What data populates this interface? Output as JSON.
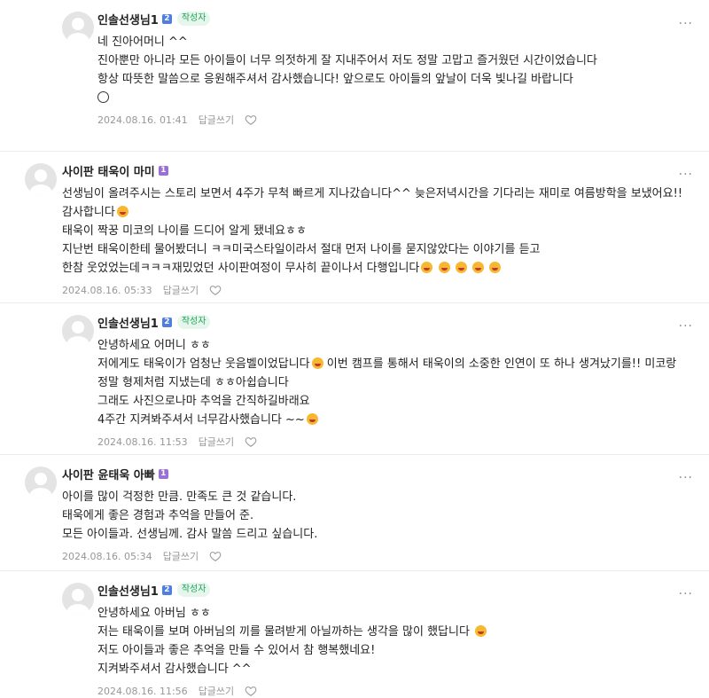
{
  "ui": {
    "reply_label": "답글쓰기",
    "author_badge": "작성자",
    "more_label": "···"
  },
  "comments": [
    {
      "nickname": "인솔선생님1",
      "level": "2",
      "is_author": true,
      "is_reply": true,
      "lines": [
        "네 진아어머니 ^^",
        "진아뿐만 아니라 모든 아이들이 너무 의젓하게 잘 지내주어서 저도 정말 고맙고 즐거웠던 시간이었습니다",
        "항상 따뜻한 말씀으로 응원해주셔서 감사했습니다! 앞으로도 아이들의 앞날이 더욱 빛나길 바랍니다"
      ],
      "date": "2024.08.16. 01:41"
    },
    {
      "nickname": "사이판 태욱이 마미",
      "level": "1",
      "is_author": false,
      "is_reply": false,
      "lines": [
        "선생님이 올려주시는 스토리 보면서 4주가 무척 빠르게 지나갔습니다^^ 늦은저녁시간을 기다리는 재미로 여름방학을 보냈어요!!감사합니다",
        "태욱이 짝꿍 미코의 나이를 드디어 알게 됐네요ㅎㅎ",
        "지난번 태욱이한테 물어봤더니 ㅋㅋ미국스타일이라서 절대 먼저 나이를 묻지않았다는 이야기를 듣고",
        "한참 웃었었는데ㅋㅋㅋ재밌었던 사이판여정이 무사히 끝이나서 다행입니다"
      ],
      "date": "2024.08.16. 05:33"
    },
    {
      "nickname": "인솔선생님1",
      "level": "2",
      "is_author": true,
      "is_reply": true,
      "lines": [
        "안녕하세요 어머니 ㅎㅎ",
        "저에게도 태욱이가 엄청난 웃음벨이었답니다",
        "이번 캠프를 통해서 태욱이의 소중한 인연이 또 하나 생겨났기를!! 미코랑 정말 형제처럼 지냈는데 ㅎㅎ아쉽습니다",
        "그래도 사진으로나마 추억을 간직하길바래요",
        "4주간 지켜봐주셔서 너무감사했습니다 ~~"
      ],
      "date": "2024.08.16. 11:53"
    },
    {
      "nickname": "사이판 윤태욱 아빠",
      "level": "1",
      "is_author": false,
      "is_reply": false,
      "lines": [
        "아이를 많이 걱정한 만큼. 만족도 큰 것 같습니다.",
        "태욱에게 좋은 경험과 추억을 만들어 준.",
        "모든 아이들과. 선생님께. 감사 말씀 드리고 싶습니다."
      ],
      "date": "2024.08.16. 05:34"
    },
    {
      "nickname": "인솔선생님1",
      "level": "2",
      "is_author": true,
      "is_reply": true,
      "lines": [
        "안녕하세요 아버님 ㅎㅎ",
        "저는 태욱이를 보며 아버님의 끼를 물려받게 아닐까하는 생각을 많이 했답니다",
        "저도 아이들과 좋은 추억을 만들 수 있어서 참 행복했네요!",
        "지켜봐주셔서 감사했습니다 ^^"
      ],
      "date": "2024.08.16. 11:56"
    }
  ]
}
